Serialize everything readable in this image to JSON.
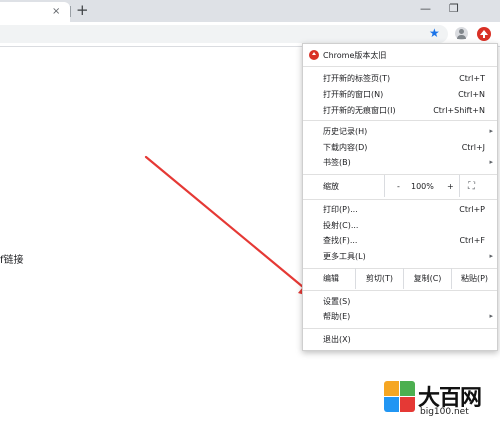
{
  "tabbar": {
    "tab_close": "×",
    "new_tab": "+",
    "minimize": "—",
    "restore": "❐"
  },
  "toolbar": {
    "bookmark_star": "★"
  },
  "page": {
    "partial_text": "f链接"
  },
  "menu": {
    "update_label": "Chrome版本太旧",
    "new_tab": {
      "label": "打开新的标签页(T)",
      "shortcut": "Ctrl+T"
    },
    "new_window": {
      "label": "打开新的窗口(N)",
      "shortcut": "Ctrl+N"
    },
    "incognito": {
      "label": "打开新的无痕窗口(I)",
      "shortcut": "Ctrl+Shift+N"
    },
    "history": {
      "label": "历史记录(H)",
      "submenu": "▸"
    },
    "downloads": {
      "label": "下载内容(D)",
      "shortcut": "Ctrl+J"
    },
    "bookmarks": {
      "label": "书签(B)",
      "submenu": "▸"
    },
    "zoom": {
      "label": "缩放",
      "minus": "-",
      "value": "100%",
      "plus": "+",
      "fullscreen": "⛶"
    },
    "print": {
      "label": "打印(P)...",
      "shortcut": "Ctrl+P"
    },
    "cast": {
      "label": "投射(C)..."
    },
    "find": {
      "label": "查找(F)...",
      "shortcut": "Ctrl+F"
    },
    "more_tools": {
      "label": "更多工具(L)",
      "submenu": "▸"
    },
    "edit": {
      "label": "编辑",
      "cut": "剪切(T)",
      "copy": "复制(C)",
      "paste": "粘贴(P)"
    },
    "settings": {
      "label": "设置(S)"
    },
    "help": {
      "label": "帮助(E)",
      "submenu": "▸"
    },
    "exit": {
      "label": "退出(X)"
    }
  },
  "watermark": {
    "title": "大百网",
    "url": "big100.net"
  },
  "colors": {
    "annotation_arrow": "#e53935",
    "update_badge": "#d93025",
    "star": "#1a73e8"
  }
}
